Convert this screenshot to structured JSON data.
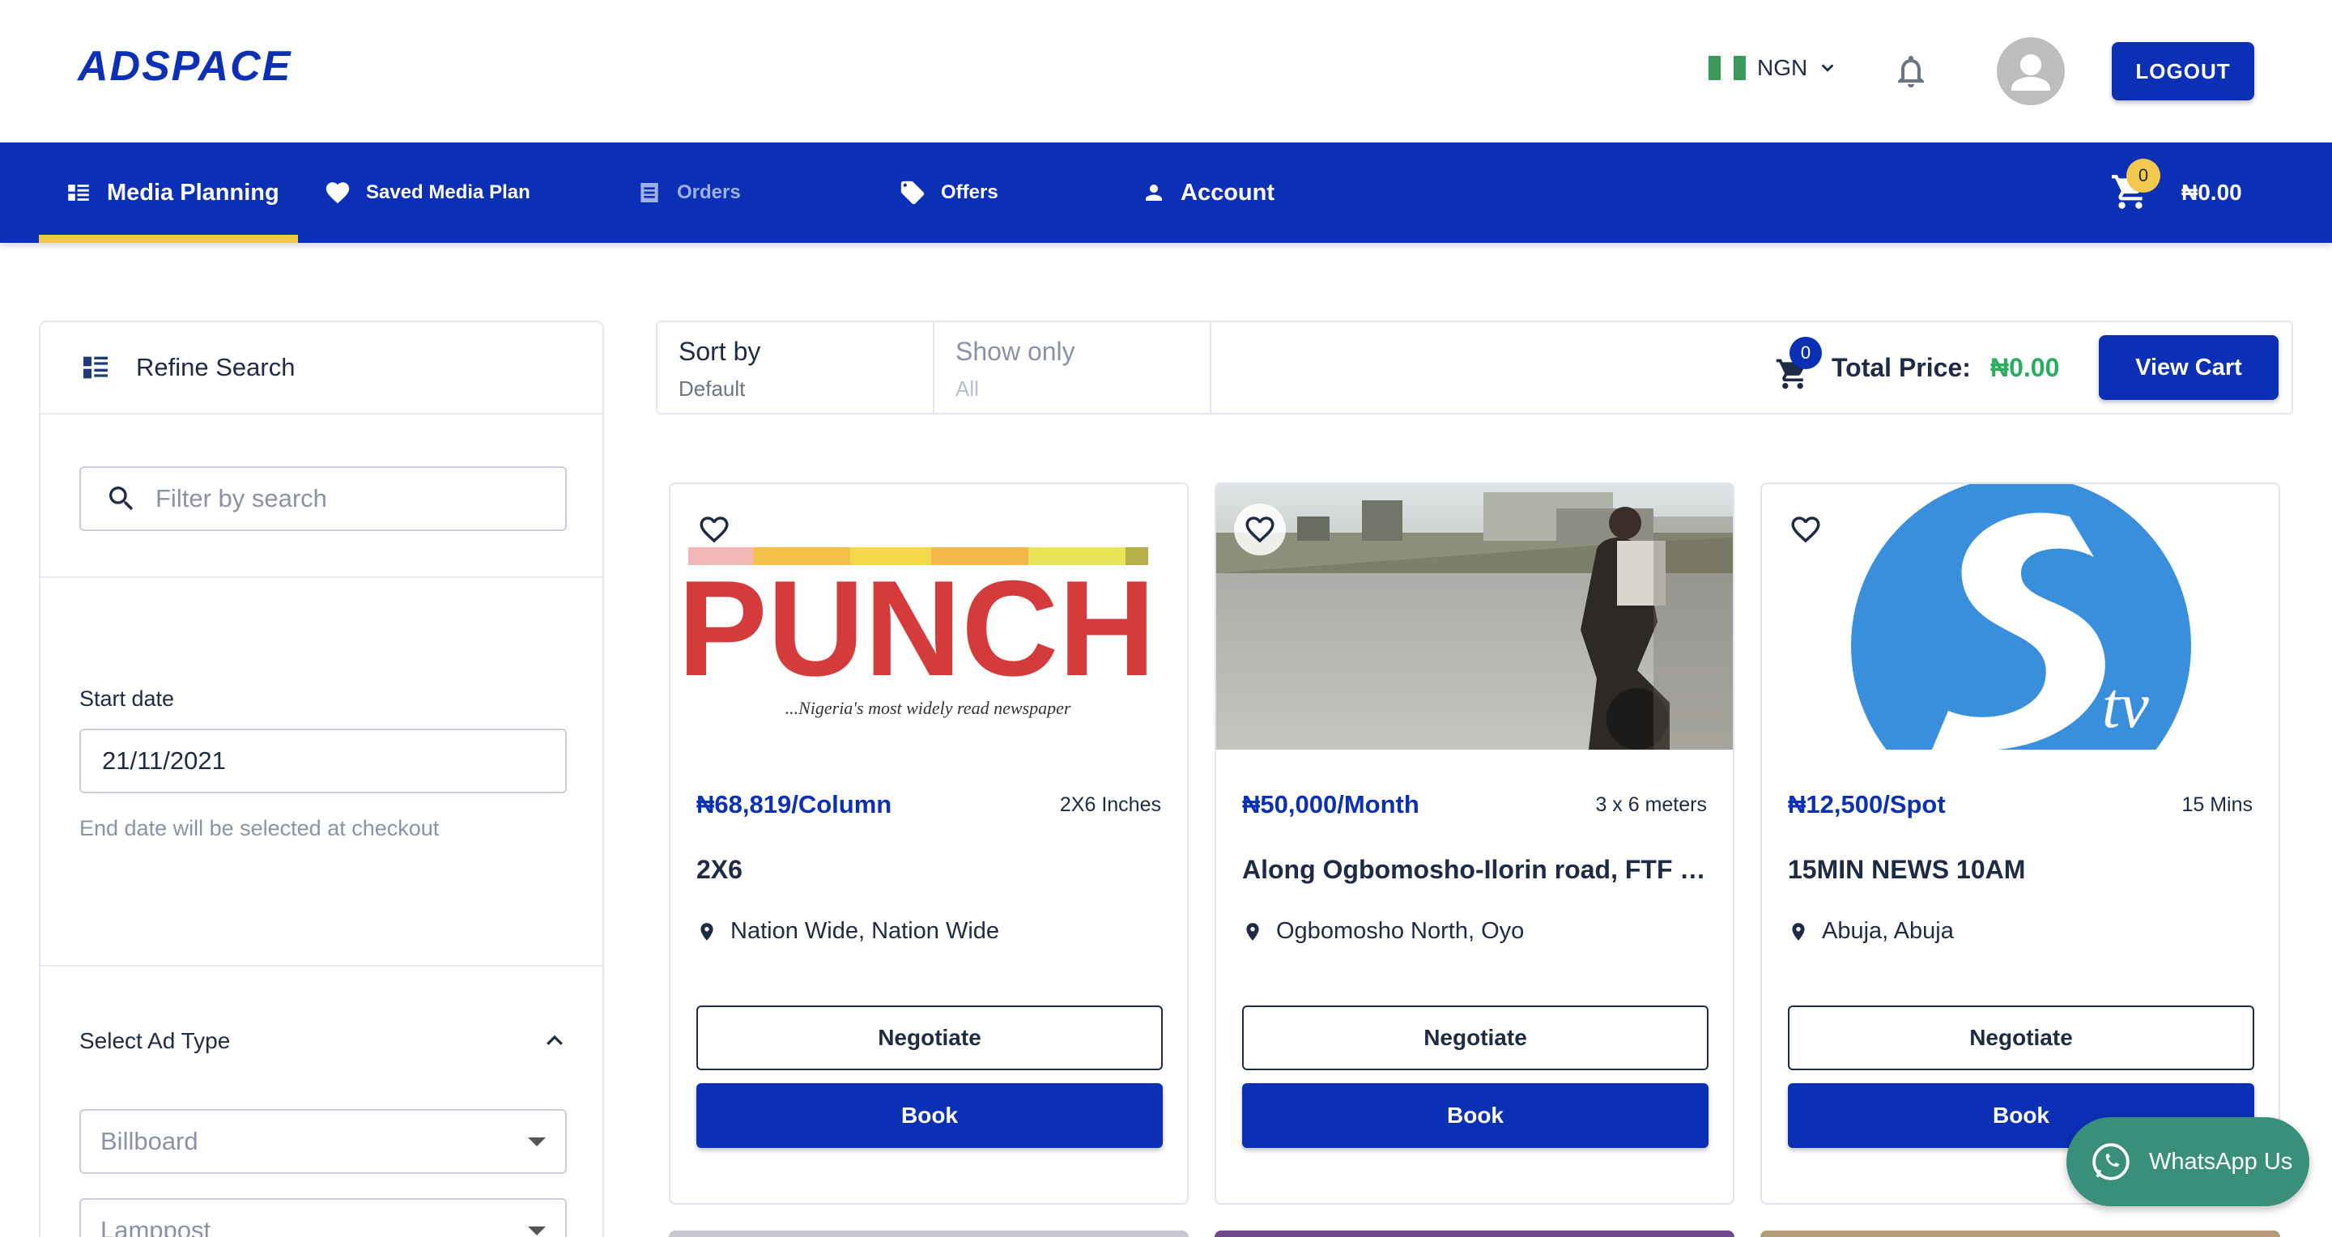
{
  "header": {
    "logo": "ADSPACE",
    "currency": "NGN",
    "logout_label": "LOGOUT",
    "flag_colors": [
      "#3a9a5b",
      "#ffffff",
      "#3a9a5b"
    ]
  },
  "nav": {
    "items": [
      {
        "label": "Media Planning",
        "icon": "list-icon",
        "active": true
      },
      {
        "label": "Saved Media Plan",
        "icon": "heart-icon"
      },
      {
        "label": "Orders",
        "icon": "receipt-icon",
        "disabled": true
      },
      {
        "label": "Offers",
        "icon": "tag-icon"
      },
      {
        "label": "Account",
        "icon": "person-icon"
      }
    ],
    "cart_count": "0",
    "cart_total": "₦0.00"
  },
  "sidebar": {
    "title": "Refine Search",
    "search_placeholder": "Filter by search",
    "start_date_label": "Start date",
    "start_date_value": "21/11/2021",
    "end_date_hint": "End date will be selected at checkout",
    "ad_type_label": "Select Ad Type",
    "ad_type_options": [
      "Billboard",
      "Lamppost"
    ]
  },
  "toolbar": {
    "sort_label": "Sort by",
    "sort_value": "Default",
    "show_label": "Show only",
    "show_value": "All",
    "cart_count": "0",
    "total_label": "Total Price:",
    "total_value": "₦0.00",
    "view_cart_label": "View Cart"
  },
  "cards": [
    {
      "price": "₦68,819/Column",
      "size": "2X6 Inches",
      "title": "2X6",
      "location": "Nation Wide, Nation Wide",
      "negotiate_label": "Negotiate",
      "book_label": "Book",
      "image": {
        "kind": "punch-logo",
        "text": "PUNCH",
        "tagline": "...Nigeria's most widely read newspaper"
      }
    },
    {
      "price": "₦50,000/Month",
      "size": "3 x 6 meters",
      "title": "Along Ogbomosho-Ilorin road, FTF Il…",
      "location": "Ogbomosho North, Oyo",
      "negotiate_label": "Negotiate",
      "book_label": "Book",
      "image": {
        "kind": "road-photo"
      }
    },
    {
      "price": "₦12,500/Spot",
      "size": "15 Mins",
      "title": "15MIN NEWS 10AM",
      "location": "Abuja, Abuja",
      "negotiate_label": "Negotiate",
      "book_label": "Book",
      "image": {
        "kind": "tv-logo",
        "text": "tv"
      }
    }
  ],
  "whatsapp": {
    "label": "WhatsApp Us"
  },
  "colors": {
    "brand": "#0b2fb5",
    "accent": "#f2c94c",
    "success": "#27ae60",
    "whatsapp": "#3a8f7a"
  }
}
